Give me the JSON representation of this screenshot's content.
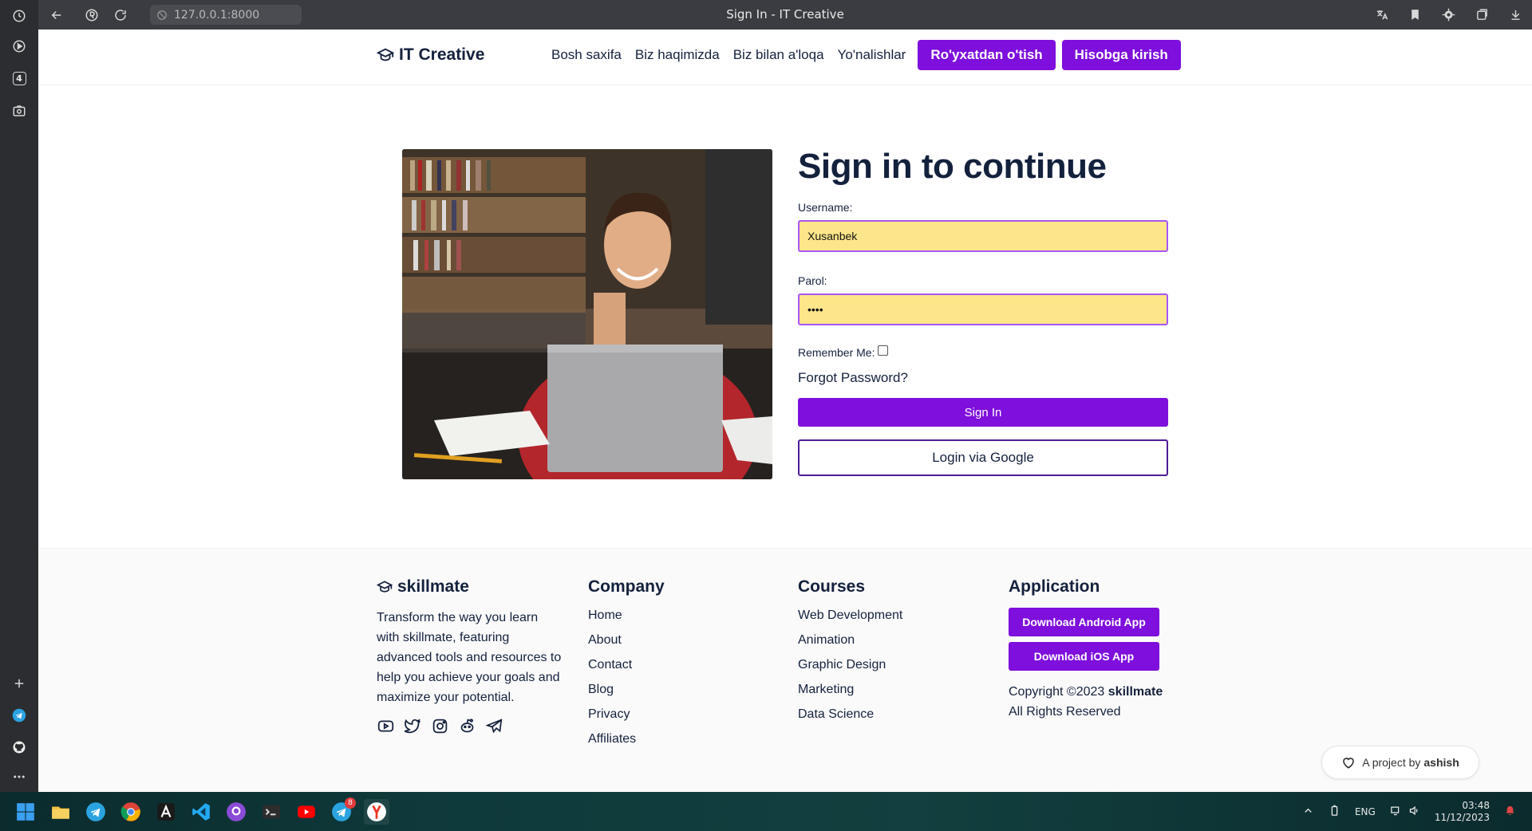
{
  "browser": {
    "url": "127.0.0.1:8000",
    "title": "Sign In - IT Creative",
    "sidebar_badge": "4"
  },
  "header": {
    "brand": "IT Creative",
    "nav": [
      "Bosh saxifa",
      "Biz haqimizda",
      "Biz bilan a'loqa",
      "Yo'nalishlar"
    ],
    "register_button": "Ro'yxatdan o'tish",
    "login_button": "Hisobga kirish"
  },
  "form": {
    "title": "Sign in to continue",
    "username_label": "Username:",
    "username_value": "Xusanbek",
    "password_label": "Parol:",
    "password_value": "••••",
    "remember_label": "Remember Me:",
    "forgot_label": "Forgot Password?",
    "signin_button": "Sign In",
    "google_button": "Login via Google"
  },
  "footer": {
    "brand": "skillmate",
    "description": "Transform the way you learn with skillmate, featuring advanced tools and resources to help you achieve your goals and maximize your potential.",
    "company": {
      "title": "Company",
      "links": [
        "Home",
        "About",
        "Contact",
        "Blog",
        "Privacy",
        "Affiliates"
      ]
    },
    "courses": {
      "title": "Courses",
      "links": [
        "Web Development",
        "Animation",
        "Graphic Design",
        "Marketing",
        "Data Science"
      ]
    },
    "application": {
      "title": "Application",
      "android_button": "Download Android App",
      "ios_button": "Download iOS App",
      "copyright_prefix": "Copyright ©2023",
      "copyright_brand": "skillmate",
      "rights": "All Rights Reserved"
    }
  },
  "project_pill": {
    "text": "A project by",
    "author": "ashish"
  },
  "taskbar": {
    "language": "ENG",
    "time": "03:48",
    "date": "11/12/2023",
    "telegram_badge": "8"
  },
  "colors": {
    "accent": "#7e0fdc",
    "text_dark": "#14213d",
    "input_bg": "#fde68a",
    "input_border": "#a855f7"
  }
}
